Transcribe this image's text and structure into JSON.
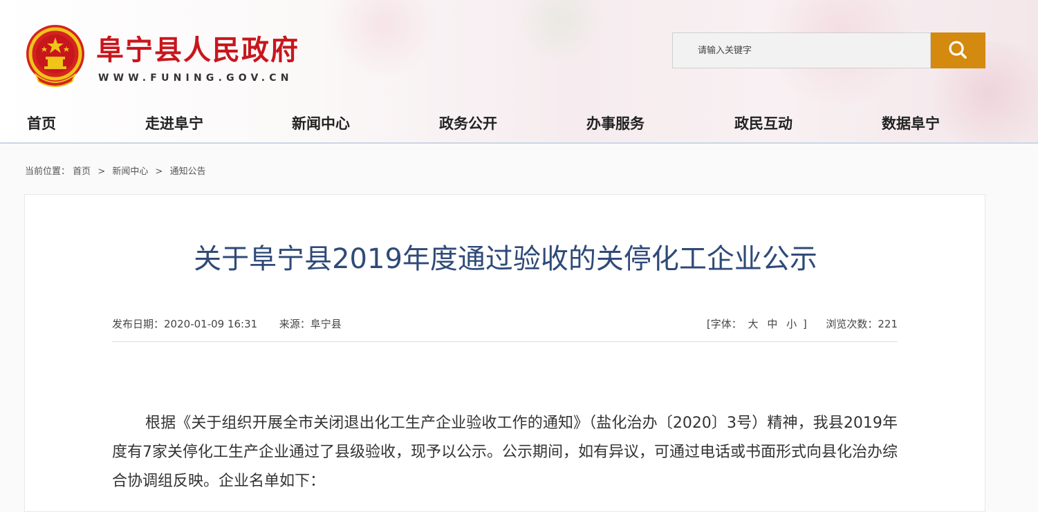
{
  "header": {
    "site_title": "阜宁县人民政府",
    "site_url": "WWW.FUNING.GOV.CN",
    "emblem_icon": "national-emblem-icon",
    "search": {
      "placeholder": "请输入关键字",
      "button_icon": "search-icon"
    }
  },
  "nav": {
    "items": [
      {
        "label": "首页"
      },
      {
        "label": "走进阜宁"
      },
      {
        "label": "新闻中心"
      },
      {
        "label": "政务公开"
      },
      {
        "label": "办事服务"
      },
      {
        "label": "政民互动"
      },
      {
        "label": "数据阜宁"
      }
    ]
  },
  "breadcrumb": {
    "prefix": "当前位置：",
    "items": [
      {
        "label": "首页"
      },
      {
        "label": "新闻中心"
      },
      {
        "label": "通知公告"
      }
    ],
    "separator": ">"
  },
  "article": {
    "title": "关于阜宁县2019年度通过验收的关停化工企业公示",
    "meta": {
      "date_label": "发布日期：",
      "date": "2020-01-09 16:31",
      "source_label": "来源：",
      "source": "阜宁县",
      "font_size_open": "[字体：",
      "font_large": "大",
      "font_medium": "中",
      "font_small": "小",
      "font_size_close": "]",
      "views_label": "浏览次数：",
      "views": "221"
    },
    "body": "根据《关于组织开展全市关闭退出化工生产企业验收工作的通知》（盐化治办〔2020〕3号）精神，我县2019年度有7家关停化工生产企业通过了县级验收，现予以公示。公示期间，如有异议，可通过电话或书面形式向县化治办综合协调组反映。企业名单如下："
  },
  "colors": {
    "brand_red": "#c8161d",
    "search_button": "#d4890f",
    "title_blue": "#2f4a78",
    "nav_underline": "#c9d6e6"
  }
}
